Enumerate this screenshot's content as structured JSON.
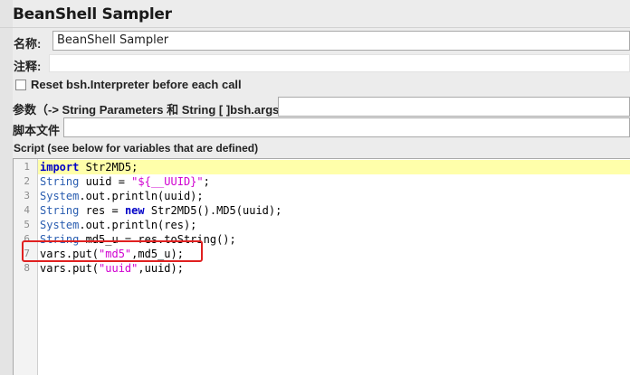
{
  "window": {
    "title": "BeanShell Sampler"
  },
  "form": {
    "name_label": "名称:",
    "name_value": "BeanShell Sampler",
    "comment_label": "注释:",
    "comment_value": "",
    "reset_label": "Reset bsh.Interpreter before each call",
    "reset_checked": false,
    "params_label": "参数（-> String Parameters 和 String [ ]bsh.args）",
    "params_value": "",
    "script_file_label": "脚本文件",
    "script_file_value": "",
    "script_label": "Script (see below for variables that are defined)"
  },
  "editor": {
    "lines": [
      {
        "num": "1",
        "tokens": [
          {
            "t": "import",
            "c": "kw"
          },
          {
            "t": " Str2MD5;",
            "c": "plain"
          }
        ]
      },
      {
        "num": "2",
        "tokens": [
          {
            "t": "String",
            "c": "ty"
          },
          {
            "t": " uuid = ",
            "c": "plain"
          },
          {
            "t": "\"${__UUID}\"",
            "c": "str"
          },
          {
            "t": ";",
            "c": "plain"
          }
        ]
      },
      {
        "num": "3",
        "tokens": [
          {
            "t": "System",
            "c": "ty"
          },
          {
            "t": ".out.println(uuid);",
            "c": "plain"
          }
        ]
      },
      {
        "num": "4",
        "tokens": [
          {
            "t": "String",
            "c": "ty"
          },
          {
            "t": " res = ",
            "c": "plain"
          },
          {
            "t": "new",
            "c": "kw"
          },
          {
            "t": " Str2MD5().MD5(uuid);",
            "c": "plain"
          }
        ]
      },
      {
        "num": "5",
        "tokens": [
          {
            "t": "System",
            "c": "ty"
          },
          {
            "t": ".out.println(res);",
            "c": "plain"
          }
        ]
      },
      {
        "num": "6",
        "tokens": [
          {
            "t": "String",
            "c": "ty"
          },
          {
            "t": " md5_u = res.toString();",
            "c": "plain"
          }
        ]
      },
      {
        "num": "7",
        "tokens": [
          {
            "t": "vars.put(",
            "c": "plain"
          },
          {
            "t": "\"md5\"",
            "c": "str"
          },
          {
            "t": ",md5_u);",
            "c": "plain"
          }
        ]
      },
      {
        "num": "8",
        "tokens": [
          {
            "t": "vars.put(",
            "c": "plain"
          },
          {
            "t": "\"uuid\"",
            "c": "str"
          },
          {
            "t": ",uuid);",
            "c": "plain"
          }
        ]
      }
    ],
    "current_line": 1,
    "highlighted_line": 7,
    "colors": {
      "keyword": "#0000c8",
      "type": "#2a5db0",
      "string": "#d000d0",
      "annotation": "#e02020",
      "current_line": "#ffffaa"
    }
  }
}
